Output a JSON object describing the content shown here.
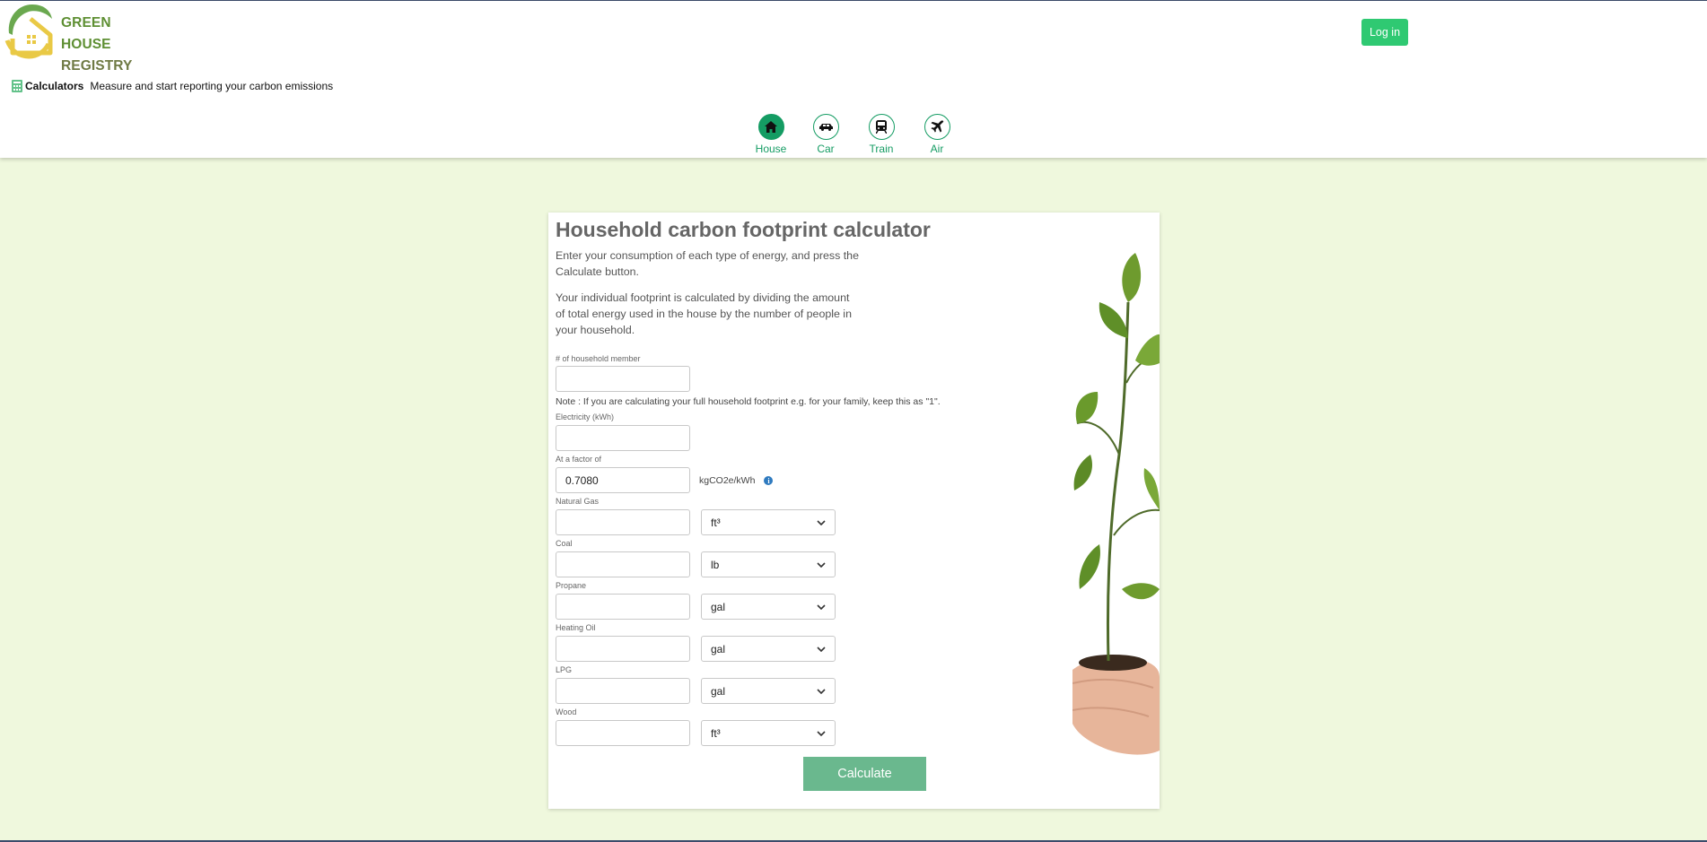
{
  "header": {
    "logo_line1": "GREEN HOUSE",
    "logo_line2": "REGISTRY",
    "login_label": "Log in",
    "breadcrumb_title": "Calculators",
    "breadcrumb_desc": "Measure and start reporting your carbon emissions"
  },
  "nav": {
    "items": [
      {
        "label": "House",
        "icon": "house-icon",
        "active": true
      },
      {
        "label": "Car",
        "icon": "car-icon",
        "active": false
      },
      {
        "label": "Train",
        "icon": "train-icon",
        "active": false
      },
      {
        "label": "Air",
        "icon": "airplane-icon",
        "active": false
      }
    ]
  },
  "calculator": {
    "title": "Household carbon footprint calculator",
    "intro1": "Enter your consumption of each type of energy, and press the Calculate button.",
    "intro2": "Your individual footprint is calculated by dividing the amount of total energy used in the house by the number of people in your household.",
    "household_label": "# of household member",
    "household_value": "",
    "note": "Note : If you are calculating your full household footprint e.g. for your family, keep this as \"1\".",
    "electricity_label": "Electricity (kWh)",
    "electricity_value": "",
    "factor_label": "At a factor of",
    "factor_value": "0.7080",
    "factor_unit": "kgCO2e/kWh",
    "fuels": [
      {
        "label": "Natural Gas",
        "value": "",
        "unit": "ft³"
      },
      {
        "label": "Coal",
        "value": "",
        "unit": "lb"
      },
      {
        "label": "Propane",
        "value": "",
        "unit": "gal"
      },
      {
        "label": "Heating Oil",
        "value": "",
        "unit": "gal"
      },
      {
        "label": "LPG",
        "value": "",
        "unit": "gal"
      },
      {
        "label": "Wood",
        "value": "",
        "unit": "ft³"
      }
    ],
    "calculate_label": "Calculate"
  },
  "colors": {
    "brand_green": "#149c63",
    "login_green": "#2fc972",
    "calculate_green": "#6ab88e",
    "page_bg": "#eff8dd"
  }
}
